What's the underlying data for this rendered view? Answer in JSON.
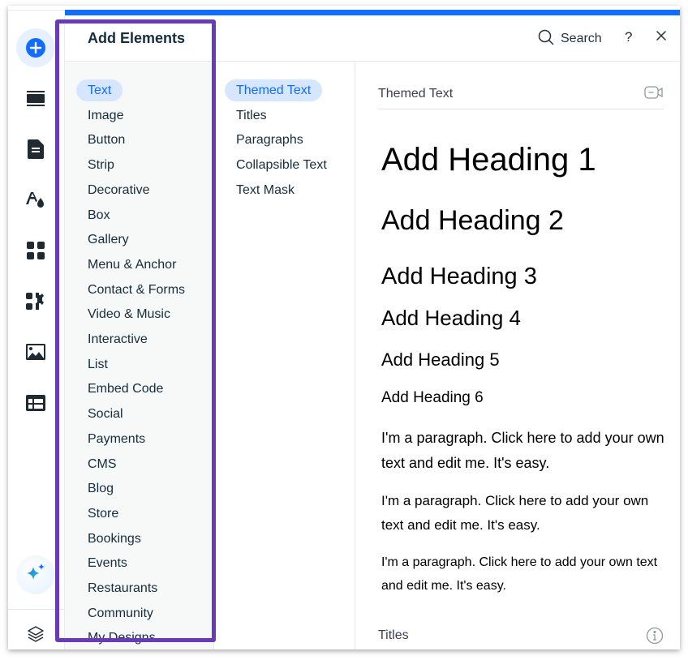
{
  "panel": {
    "title": "Add Elements",
    "search_label": "Search",
    "help_label": "?"
  },
  "rail": {
    "items": [
      {
        "name": "add-elements",
        "icon": "plus-circle-icon"
      },
      {
        "name": "sections",
        "icon": "sections-icon"
      },
      {
        "name": "pages",
        "icon": "page-icon"
      },
      {
        "name": "site-design",
        "icon": "theme-icon"
      },
      {
        "name": "apps",
        "icon": "apps-grid-icon"
      },
      {
        "name": "business-tools",
        "icon": "puzzle-gear-icon"
      },
      {
        "name": "media",
        "icon": "image-icon"
      },
      {
        "name": "cms",
        "icon": "table-icon"
      },
      {
        "name": "ai-assistant",
        "icon": "sparkle-icon"
      },
      {
        "name": "layers",
        "icon": "layers-icon"
      }
    ]
  },
  "categories": [
    {
      "label": "Text",
      "active": true
    },
    {
      "label": "Image"
    },
    {
      "label": "Button"
    },
    {
      "label": "Strip"
    },
    {
      "label": "Decorative"
    },
    {
      "label": "Box"
    },
    {
      "label": "Gallery"
    },
    {
      "label": "Menu & Anchor"
    },
    {
      "label": "Contact & Forms"
    },
    {
      "label": "Video & Music"
    },
    {
      "label": "Interactive"
    },
    {
      "label": "List"
    },
    {
      "label": "Embed Code"
    },
    {
      "label": "Social"
    },
    {
      "label": "Payments"
    },
    {
      "label": "CMS"
    },
    {
      "label": "Blog"
    },
    {
      "label": "Store"
    },
    {
      "label": "Bookings"
    },
    {
      "label": "Events"
    },
    {
      "label": "Restaurants"
    },
    {
      "label": "Community"
    },
    {
      "label": "My Designs"
    }
  ],
  "subcategories": [
    {
      "label": "Themed Text",
      "active": true
    },
    {
      "label": "Titles"
    },
    {
      "label": "Paragraphs"
    },
    {
      "label": "Collapsible Text"
    },
    {
      "label": "Text Mask"
    }
  ],
  "content": {
    "section_themed": "Themed Text",
    "headings": [
      "Add Heading 1",
      "Add Heading 2",
      "Add Heading 3",
      "Add Heading 4",
      "Add Heading 5",
      "Add Heading 6"
    ],
    "paragraphs": [
      "I'm a paragraph. Click here to add your own text and edit me. It's easy.",
      "I'm a paragraph. Click here to add your own text and edit me. It's easy.",
      "I'm a paragraph. Click here to add your own text and edit me. It's easy."
    ],
    "section_titles": "Titles"
  },
  "colors": {
    "accent": "#116dff",
    "active_bg": "#d6e6fe",
    "highlight": "#6a3bb8"
  }
}
